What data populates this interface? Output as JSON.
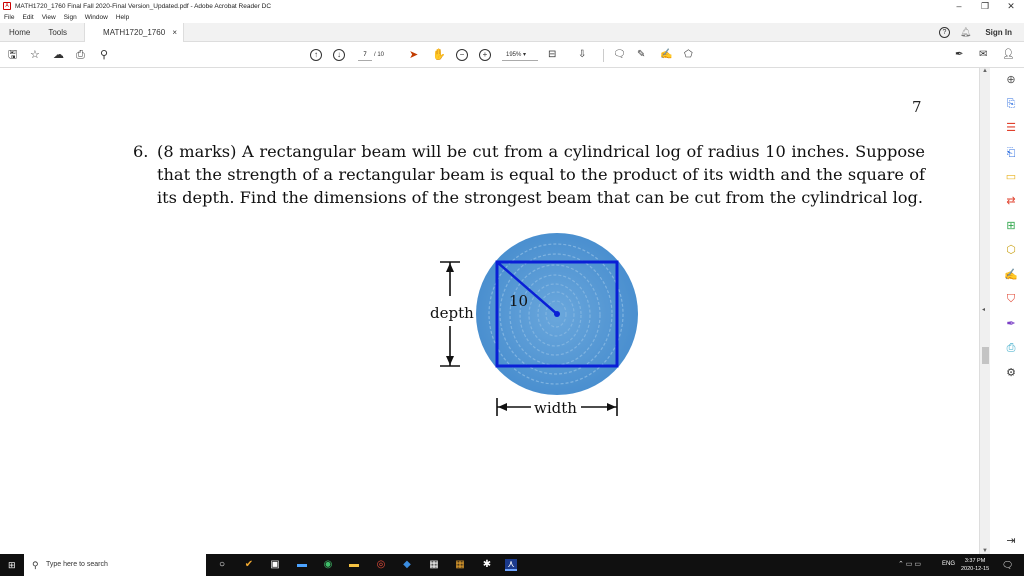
{
  "window": {
    "title": "MATH1720_1760 Final Fall 2020-Final Version_Updated.pdf - Adobe Acrobat Reader DC",
    "minimize": "–",
    "restore": "❐",
    "close": "✕"
  },
  "menu": [
    "File",
    "Edit",
    "View",
    "Sign",
    "Window",
    "Help"
  ],
  "tabs": {
    "home": "Home",
    "tools": "Tools",
    "document": "MATH1720_1760 F...",
    "document_close": "×",
    "help": "?",
    "sign_in": "Sign In"
  },
  "toolbar": {
    "current_page": "7",
    "total_pages": "/ 10",
    "zoom": "195%"
  },
  "document": {
    "page_number": "7",
    "problem_number": "6.",
    "problem_text": "(8 marks) A rectangular beam will be cut from a cylindrical log of radius 10 inches. Suppose that the strength of a rectangular beam is equal to the product of its width and the square of its depth. Find the dimensions of the strongest beam that can be cut from the cylindrical log.",
    "figure": {
      "radius_label": "10",
      "depth_label": "depth",
      "width_label": "width",
      "colors": {
        "log": "#5b9bd5",
        "beam": "#0a1fd6"
      }
    }
  },
  "taskbar": {
    "search_placeholder": "Type here to search",
    "language": "ENG",
    "time": "3:37 PM",
    "date": "2020-12-15"
  }
}
